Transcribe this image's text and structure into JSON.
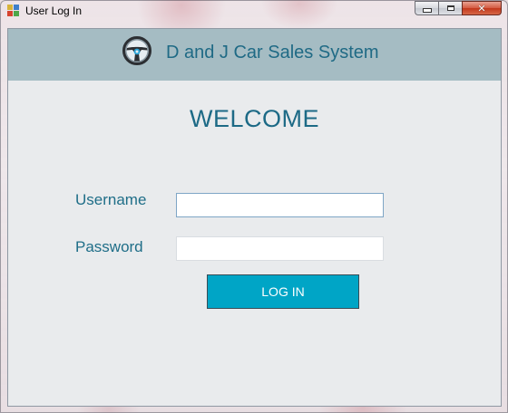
{
  "window": {
    "title": "User Log In",
    "controls": {
      "minimize_icon": "minimize-icon",
      "maximize_icon": "maximize-icon",
      "close_glyph": "✕"
    }
  },
  "header": {
    "title": "D and J Car Sales System",
    "icon": "steering-wheel-icon",
    "background_color": "#a5bcc3"
  },
  "main": {
    "heading": "WELCOME",
    "username": {
      "label": "Username",
      "value": "",
      "placeholder": ""
    },
    "password": {
      "label": "Password",
      "value": "",
      "placeholder": ""
    },
    "login_button": {
      "label": "LOG IN",
      "color": "#00a5c6"
    }
  },
  "colors": {
    "accent_text": "#1f6e88",
    "client_background": "#e9ebed"
  }
}
